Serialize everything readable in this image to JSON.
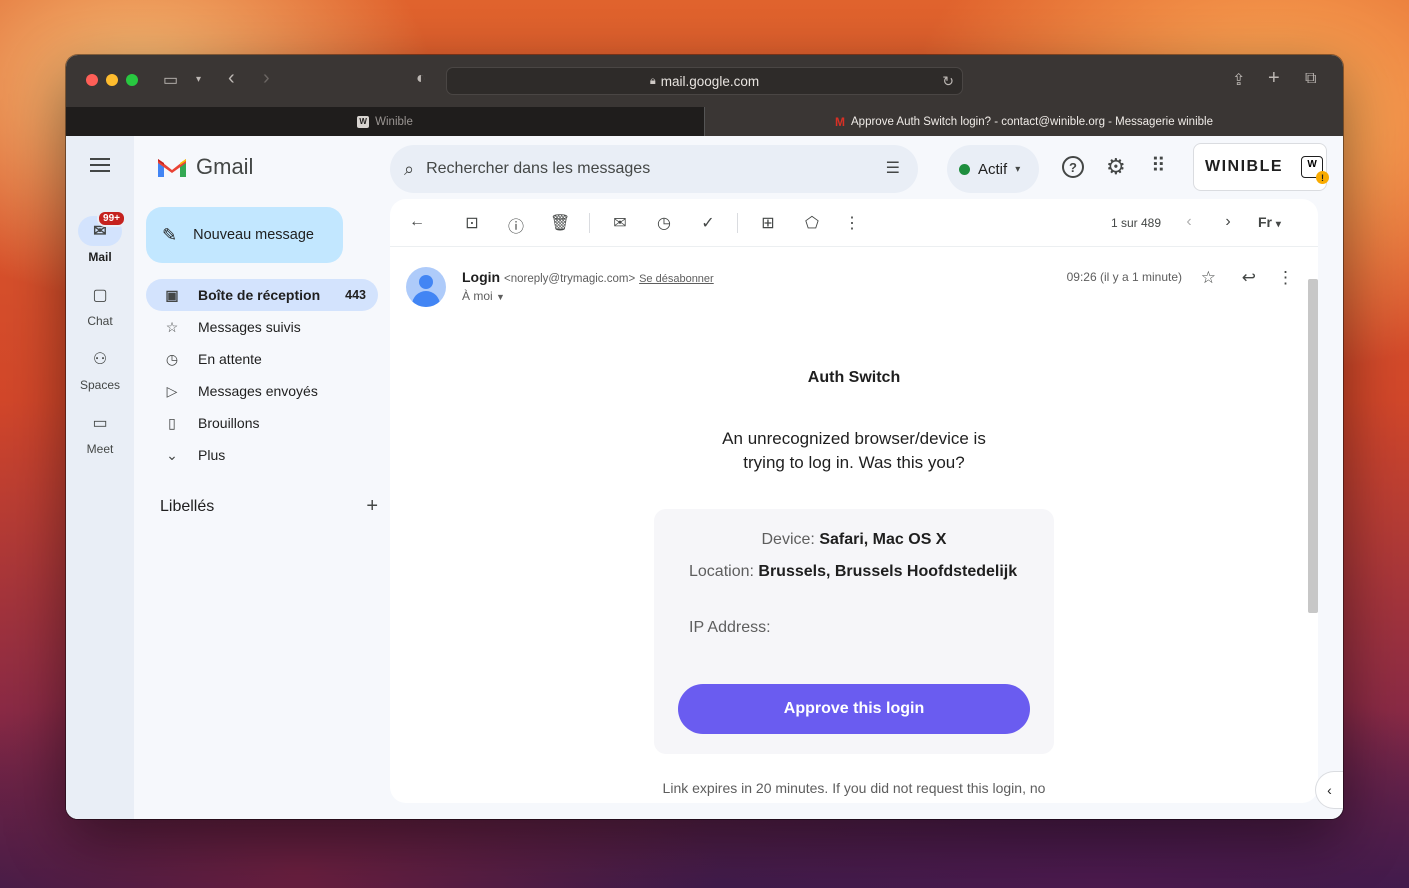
{
  "browser": {
    "url": "mail.google.com",
    "tabs": [
      {
        "label": "Winible",
        "active": false
      },
      {
        "label": "Approve Auth Switch login? - contact@winible.org - Messagerie winible",
        "active": true
      }
    ]
  },
  "rail": {
    "mail": {
      "label": "Mail",
      "badge": "99+"
    },
    "chat": {
      "label": "Chat"
    },
    "spaces": {
      "label": "Spaces"
    },
    "meet": {
      "label": "Meet"
    }
  },
  "header": {
    "logo_text": "Gmail",
    "search_placeholder": "Rechercher dans les messages",
    "status_label": "Actif",
    "account_name": "WINIBLE"
  },
  "compose_label": "Nouveau message",
  "nav": {
    "inbox": {
      "label": "Boîte de réception",
      "count": "443"
    },
    "starred": {
      "label": "Messages suivis"
    },
    "snoozed": {
      "label": "En attente"
    },
    "sent": {
      "label": "Messages envoyés"
    },
    "drafts": {
      "label": "Brouillons"
    },
    "more": {
      "label": "Plus"
    }
  },
  "labels_heading": "Libellés",
  "toolbar": {
    "pager": "1 sur 489",
    "lang": "Fr"
  },
  "message": {
    "sender_name": "Login",
    "sender_email": "<noreply@trymagic.com>",
    "unsubscribe": "Se désabonner",
    "to": "À moi",
    "time": "09:26 (il y a 1 minute)"
  },
  "email": {
    "title": "Auth Switch",
    "text": "An unrecognized browser/device is trying to log in. Was this you?",
    "device_label": "Device:",
    "device_value": "Safari, Mac OS X",
    "location_label": "Location:",
    "location_value": "Brussels, Brussels Hoofdstedelijk",
    "ip_label": "IP Address:",
    "approve_label": "Approve this login",
    "footnote": "Link expires in 20 minutes. If you did not request this login, no"
  },
  "colors": {
    "compose_bg": "#c2e7ff",
    "selected_nav": "#d3e3fd",
    "approve_button": "#6a5cf0",
    "status_dot": "#1e8e3e"
  }
}
